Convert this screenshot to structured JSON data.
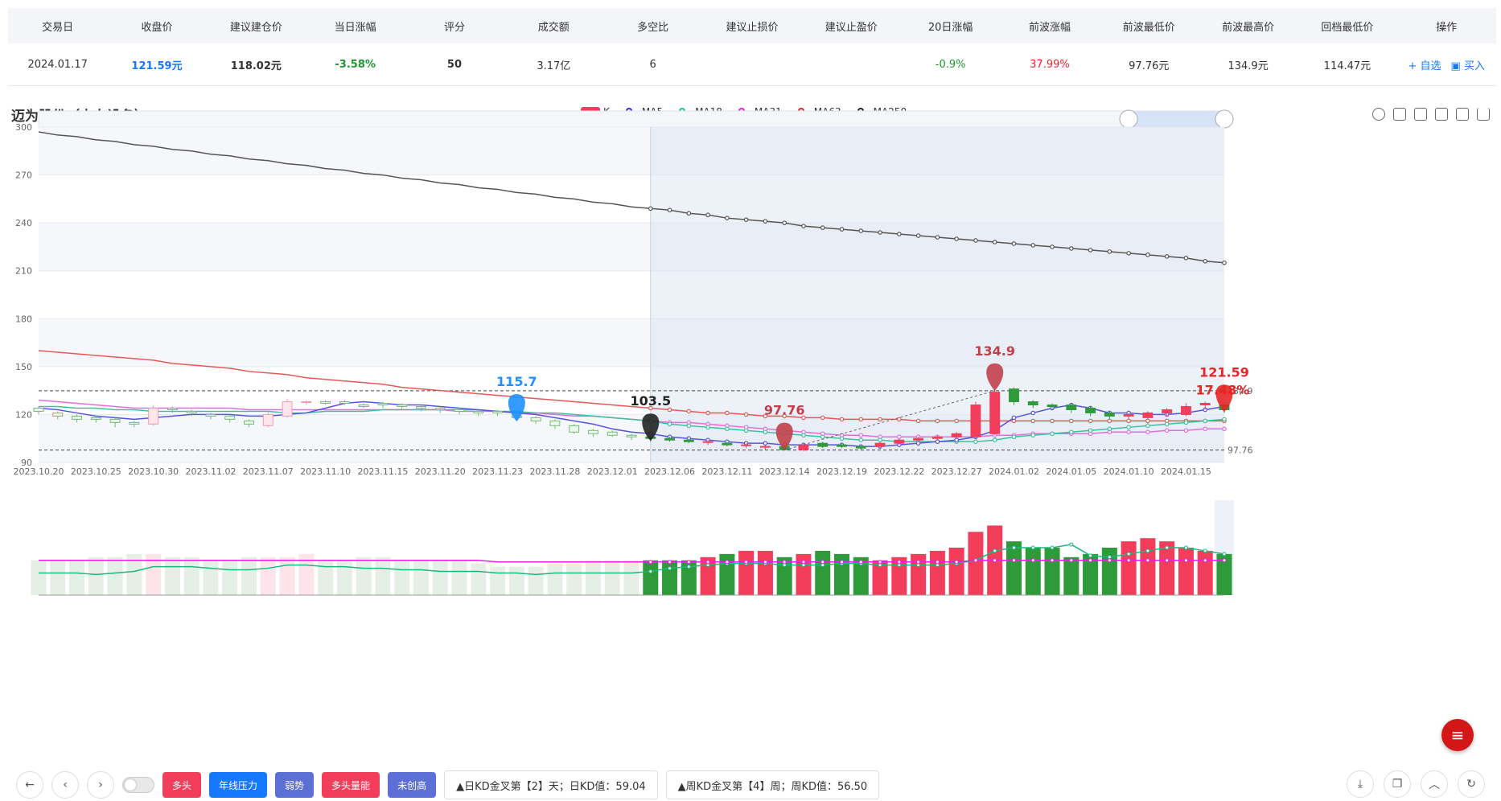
{
  "table": {
    "headers": [
      "交易日",
      "收盘价",
      "建议建仓价",
      "当日涨幅",
      "评分",
      "成交额",
      "多空比",
      "建议止损价",
      "建议止盈价",
      "20日涨幅",
      "前波涨幅",
      "前波最低价",
      "前波最高价",
      "回档最低价",
      "操作"
    ],
    "row": {
      "date": "2024.01.17",
      "close": "121.59元",
      "build_price": "118.02元",
      "day_change": "-3.58%",
      "score": "50",
      "turnover": "3.17亿",
      "ls_ratio": "6",
      "stop_loss": "",
      "take_profit": "",
      "change_20d": "-0.9%",
      "prev_wave_change": "37.99%",
      "prev_wave_low": "97.76元",
      "prev_wave_high": "134.9元",
      "pullback_low": "114.47元"
    },
    "ops": {
      "watch": "+ 自选",
      "buy": "买入"
    }
  },
  "chart_title": "迈为股份（电力设备）",
  "legend": [
    {
      "name": "K",
      "color": "#f23d5b"
    },
    {
      "name": "MA5",
      "color": "#2a2ae0"
    },
    {
      "name": "MA18",
      "color": "#19c08a"
    },
    {
      "name": "MA31",
      "color": "#e81ee8"
    },
    {
      "name": "MA63",
      "color": "#e52626"
    },
    {
      "name": "MA250",
      "color": "#222222"
    }
  ],
  "chart_data": {
    "type": "candlestick",
    "ylim": [
      90,
      300
    ],
    "yticks": [
      90,
      120,
      150,
      180,
      210,
      240,
      270,
      300
    ],
    "x_tick_labels": [
      "2023.10.20",
      "2023.10.25",
      "2023.10.30",
      "2023.11.02",
      "2023.11.07",
      "2023.11.10",
      "2023.11.15",
      "2023.11.20",
      "2023.11.23",
      "2023.11.28",
      "2023.12.01",
      "2023.12.06",
      "2023.12.11",
      "2023.12.14",
      "2023.12.19",
      "2023.12.22",
      "2023.12.27",
      "2024.01.02",
      "2024.01.05",
      "2024.01.10",
      "2024.01.15"
    ],
    "dates": [
      "2023.10.20",
      "2023.10.23",
      "2023.10.24",
      "2023.10.25",
      "2023.10.26",
      "2023.10.27",
      "2023.10.30",
      "2023.10.31",
      "2023.11.01",
      "2023.11.02",
      "2023.11.03",
      "2023.11.06",
      "2023.11.07",
      "2023.11.08",
      "2023.11.09",
      "2023.11.10",
      "2023.11.13",
      "2023.11.14",
      "2023.11.15",
      "2023.11.16",
      "2023.11.17",
      "2023.11.20",
      "2023.11.21",
      "2023.11.22",
      "2023.11.23",
      "2023.11.24",
      "2023.11.27",
      "2023.11.28",
      "2023.11.29",
      "2023.11.30",
      "2023.12.01",
      "2023.12.04",
      "2023.12.05",
      "2023.12.06",
      "2023.12.07",
      "2023.12.08",
      "2023.12.11",
      "2023.12.12",
      "2023.12.13",
      "2023.12.14",
      "2023.12.15",
      "2023.12.18",
      "2023.12.19",
      "2023.12.20",
      "2023.12.21",
      "2023.12.22",
      "2023.12.25",
      "2023.12.26",
      "2023.12.27",
      "2023.12.28",
      "2023.12.29",
      "2024.01.02",
      "2024.01.03",
      "2024.01.04",
      "2024.01.05",
      "2024.01.08",
      "2024.01.09",
      "2024.01.10",
      "2024.01.11",
      "2024.01.12",
      "2024.01.15",
      "2024.01.16",
      "2024.01.17"
    ],
    "open": [
      124,
      121,
      119,
      118,
      117,
      115,
      114,
      124,
      122,
      120,
      119,
      116,
      113,
      119,
      128,
      128,
      128,
      126,
      127,
      126,
      125,
      124,
      123,
      122,
      122,
      119,
      118,
      116,
      113,
      110,
      109,
      107,
      106,
      105,
      104,
      103,
      102,
      101,
      100,
      100,
      98,
      102,
      101,
      100,
      100,
      102,
      104,
      105,
      106,
      106,
      108,
      136,
      128,
      126,
      126,
      124,
      121,
      119,
      118,
      121,
      120,
      126,
      126
    ],
    "close": [
      122,
      119,
      117,
      117,
      115,
      114,
      124,
      123,
      121,
      119,
      117,
      114,
      120,
      128,
      128,
      127,
      127,
      125,
      126,
      125,
      124,
      123,
      122,
      121,
      121,
      118,
      116,
      113,
      109,
      108,
      107,
      106,
      105,
      104,
      103,
      103,
      101,
      101,
      100,
      98,
      101,
      100,
      100,
      99,
      102,
      104,
      105,
      106,
      108,
      126,
      134,
      128,
      126,
      125,
      123,
      121,
      119,
      120,
      121,
      123,
      125,
      127,
      123
    ],
    "high": [
      125,
      122,
      120,
      119,
      118,
      116,
      126,
      125,
      123,
      121,
      120,
      117,
      122,
      130,
      129,
      129,
      129,
      127,
      128,
      127,
      126,
      125,
      124,
      123,
      123,
      120,
      119,
      117,
      114,
      111,
      110,
      108,
      107,
      106,
      105,
      104,
      103,
      102,
      101,
      101,
      102,
      103,
      102,
      101,
      103,
      105,
      106,
      107,
      109,
      128,
      136,
      137,
      129,
      127,
      127,
      125,
      122,
      121,
      122,
      124,
      127,
      128,
      128
    ],
    "low": [
      120,
      117,
      115,
      115,
      112,
      112,
      113,
      121,
      119,
      117,
      115,
      112,
      112,
      118,
      126,
      126,
      126,
      124,
      124,
      123,
      122,
      121,
      120,
      119,
      119,
      116,
      114,
      111,
      108,
      106,
      106,
      104,
      103,
      103,
      102,
      101,
      100,
      99,
      98,
      97.76,
      97,
      99,
      99,
      98,
      99,
      101,
      103,
      104,
      105,
      105,
      107,
      126,
      124,
      123,
      121,
      119,
      117,
      117,
      117,
      119,
      119,
      123,
      121
    ],
    "ma5": [
      124,
      123,
      121,
      119,
      118,
      117,
      118,
      119,
      120,
      120,
      120,
      119,
      119,
      120,
      121,
      124,
      127,
      128,
      127,
      126,
      126,
      125,
      124,
      123,
      122,
      121,
      120,
      118,
      116,
      114,
      111,
      109,
      108,
      106,
      105,
      104,
      103,
      102,
      102,
      101,
      101,
      101,
      101,
      100,
      100,
      101,
      102,
      103,
      104,
      106,
      110,
      118,
      121,
      124,
      126,
      124,
      121,
      121,
      120,
      120,
      121,
      123,
      125
    ],
    "ma18": [
      125,
      125,
      124,
      124,
      123,
      123,
      122,
      122,
      122,
      122,
      122,
      122,
      122,
      121,
      121,
      122,
      122,
      122,
      123,
      123,
      123,
      123,
      123,
      123,
      122,
      122,
      121,
      121,
      120,
      119,
      118,
      117,
      116,
      114,
      113,
      112,
      111,
      110,
      109,
      108,
      107,
      106,
      105,
      104,
      104,
      103,
      103,
      103,
      103,
      103,
      104,
      106,
      107,
      108,
      109,
      110,
      111,
      112,
      113,
      114,
      115,
      116,
      117
    ],
    "ma31": [
      129,
      128,
      127,
      126,
      125,
      124,
      124,
      124,
      124,
      124,
      124,
      123,
      123,
      123,
      123,
      123,
      123,
      123,
      123,
      123,
      123,
      123,
      122,
      122,
      122,
      121,
      121,
      120,
      119,
      119,
      118,
      117,
      116,
      115,
      115,
      114,
      113,
      112,
      111,
      110,
      109,
      108,
      107,
      107,
      106,
      106,
      106,
      106,
      106,
      106,
      107,
      107,
      108,
      108,
      108,
      108,
      109,
      109,
      109,
      110,
      110,
      111,
      111
    ],
    "ma63": [
      160,
      159,
      158,
      157,
      156,
      155,
      154,
      152,
      151,
      150,
      149,
      147,
      146,
      145,
      143,
      142,
      141,
      140,
      139,
      137,
      136,
      135,
      134,
      133,
      132,
      131,
      130,
      129,
      128,
      127,
      126,
      125,
      124,
      123,
      122,
      121,
      121,
      120,
      119,
      119,
      118,
      118,
      117,
      117,
      117,
      117,
      116,
      116,
      116,
      116,
      116,
      116,
      116,
      116,
      116,
      116,
      116,
      116,
      116,
      116,
      116,
      116,
      116
    ],
    "ma250": [
      297,
      295,
      294,
      292,
      291,
      289,
      288,
      286,
      285,
      283,
      282,
      280,
      279,
      277,
      276,
      274,
      273,
      271,
      270,
      268,
      267,
      265,
      264,
      262,
      261,
      259,
      258,
      256,
      255,
      253,
      252,
      250,
      249,
      248,
      246,
      245,
      243,
      242,
      241,
      240,
      238,
      237,
      236,
      235,
      234,
      233,
      232,
      231,
      230,
      229,
      228,
      227,
      226,
      225,
      224,
      223,
      222,
      221,
      220,
      219,
      218,
      216,
      215
    ],
    "volume": [
      22,
      22,
      22,
      24,
      24,
      26,
      26,
      24,
      24,
      22,
      22,
      24,
      24,
      24,
      26,
      22,
      22,
      24,
      24,
      22,
      22,
      22,
      22,
      20,
      18,
      18,
      18,
      20,
      20,
      22,
      22,
      22,
      22,
      22,
      22,
      24,
      26,
      28,
      28,
      24,
      26,
      28,
      26,
      24,
      22,
      24,
      26,
      28,
      30,
      40,
      44,
      34,
      30,
      30,
      24,
      26,
      30,
      34,
      36,
      34,
      30,
      28,
      26
    ],
    "vol_ma_green": [
      14,
      14,
      14,
      13,
      14,
      15,
      18,
      18,
      18,
      17,
      16,
      16,
      17,
      19,
      19,
      18,
      18,
      17,
      17,
      16,
      16,
      15,
      15,
      15,
      14,
      14,
      13,
      14,
      14,
      14,
      14,
      14,
      15,
      17,
      18,
      19,
      20,
      20,
      20,
      19,
      19,
      19,
      20,
      20,
      19,
      19,
      19,
      19,
      20,
      22,
      28,
      30,
      30,
      30,
      32,
      25,
      24,
      26,
      28,
      30,
      30,
      28,
      26
    ],
    "vol_ma_pink": [
      22,
      22,
      22,
      22,
      22,
      22,
      22,
      22,
      22,
      22,
      22,
      22,
      22,
      22,
      22,
      22,
      22,
      22,
      22,
      22,
      22,
      22,
      22,
      22,
      21,
      21,
      21,
      21,
      21,
      21,
      21,
      21,
      21,
      21,
      21,
      21,
      21,
      21,
      21,
      21,
      21,
      21,
      21,
      21,
      21,
      21,
      21,
      21,
      21,
      22,
      22,
      22,
      22,
      22,
      22,
      22,
      22,
      22,
      22,
      22,
      22,
      22,
      22
    ],
    "ylim_volume": [
      0,
      60
    ],
    "highlight_start_index": 32,
    "hlines": [
      134.9,
      97.76
    ],
    "hline_labels": [
      "134.9",
      "97.76"
    ],
    "markers": [
      {
        "label": "115.7",
        "date": "2023.11.24",
        "value": 115.7,
        "color": "#1e90ff"
      },
      {
        "label": "103.5",
        "date": "2023.12.05",
        "value": 103.5,
        "color": "#222222"
      },
      {
        "label": "97.76",
        "date": "2023.12.14",
        "value": 97.76,
        "color": "#c0404a"
      },
      {
        "label": "134.9",
        "date": "2023.12.29",
        "value": 134.9,
        "color": "#c0404a"
      },
      {
        "label": "121.59",
        "date": "2024.01.17",
        "value": 121.59,
        "color": "#e52626"
      }
    ],
    "last_change": "17.48%"
  },
  "bottom": {
    "tags": [
      {
        "label": "多头",
        "color": "#f23d5b"
      },
      {
        "label": "年线压力",
        "color": "#1677ff"
      },
      {
        "label": "弱势",
        "color": "#5b6fd6"
      },
      {
        "label": "多头量能",
        "color": "#f23d5b"
      },
      {
        "label": "未创高",
        "color": "#5b6fd6"
      }
    ],
    "notes": [
      "▲日KD金叉第【2】天；日KD值：59.04",
      "▲周KD金叉第【4】周；周KD值：56.50"
    ]
  }
}
